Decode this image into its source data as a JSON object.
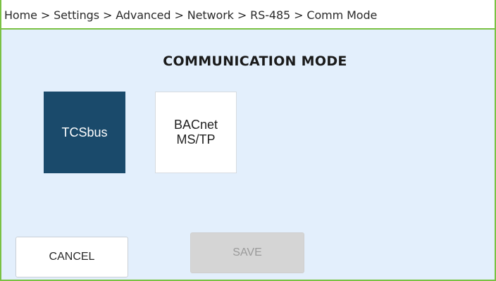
{
  "breadcrumb": {
    "text": "Home > Settings > Advanced > Network > RS-485 > Comm Mode"
  },
  "page": {
    "title": "COMMUNICATION MODE"
  },
  "modes": [
    {
      "label": "TCSbus",
      "selected": true
    },
    {
      "label": "BACnet\nMS/TP",
      "selected": false
    }
  ],
  "actions": {
    "cancel_label": "CANCEL",
    "save_label": "SAVE",
    "save_enabled": false
  },
  "colors": {
    "accent_border": "#7ac143",
    "background": "#e3effc",
    "selected_tile": "#1a4a6b",
    "disabled_button": "#d5d5d5"
  }
}
